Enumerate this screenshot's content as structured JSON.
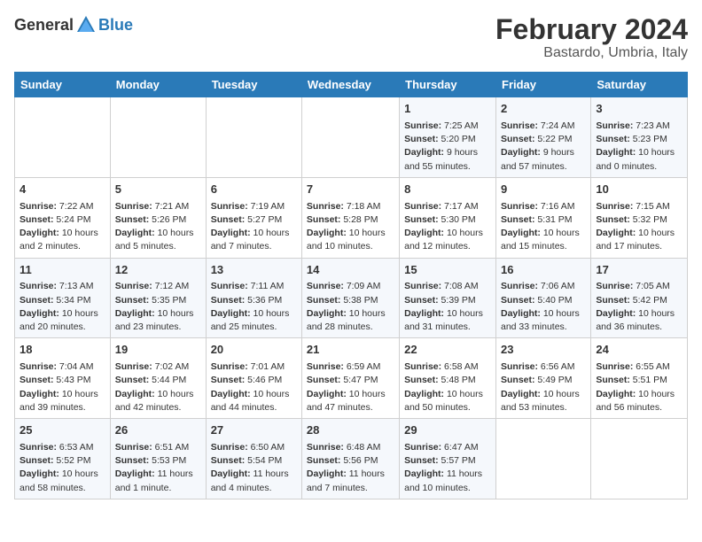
{
  "logo": {
    "general": "General",
    "blue": "Blue"
  },
  "title": "February 2024",
  "subtitle": "Bastardo, Umbria, Italy",
  "days_of_week": [
    "Sunday",
    "Monday",
    "Tuesday",
    "Wednesday",
    "Thursday",
    "Friday",
    "Saturday"
  ],
  "weeks": [
    [
      {
        "day": "",
        "info": ""
      },
      {
        "day": "",
        "info": ""
      },
      {
        "day": "",
        "info": ""
      },
      {
        "day": "",
        "info": ""
      },
      {
        "day": "1",
        "info": "Sunrise: 7:25 AM\nSunset: 5:20 PM\nDaylight: 9 hours and 55 minutes."
      },
      {
        "day": "2",
        "info": "Sunrise: 7:24 AM\nSunset: 5:22 PM\nDaylight: 9 hours and 57 minutes."
      },
      {
        "day": "3",
        "info": "Sunrise: 7:23 AM\nSunset: 5:23 PM\nDaylight: 10 hours and 0 minutes."
      }
    ],
    [
      {
        "day": "4",
        "info": "Sunrise: 7:22 AM\nSunset: 5:24 PM\nDaylight: 10 hours and 2 minutes."
      },
      {
        "day": "5",
        "info": "Sunrise: 7:21 AM\nSunset: 5:26 PM\nDaylight: 10 hours and 5 minutes."
      },
      {
        "day": "6",
        "info": "Sunrise: 7:19 AM\nSunset: 5:27 PM\nDaylight: 10 hours and 7 minutes."
      },
      {
        "day": "7",
        "info": "Sunrise: 7:18 AM\nSunset: 5:28 PM\nDaylight: 10 hours and 10 minutes."
      },
      {
        "day": "8",
        "info": "Sunrise: 7:17 AM\nSunset: 5:30 PM\nDaylight: 10 hours and 12 minutes."
      },
      {
        "day": "9",
        "info": "Sunrise: 7:16 AM\nSunset: 5:31 PM\nDaylight: 10 hours and 15 minutes."
      },
      {
        "day": "10",
        "info": "Sunrise: 7:15 AM\nSunset: 5:32 PM\nDaylight: 10 hours and 17 minutes."
      }
    ],
    [
      {
        "day": "11",
        "info": "Sunrise: 7:13 AM\nSunset: 5:34 PM\nDaylight: 10 hours and 20 minutes."
      },
      {
        "day": "12",
        "info": "Sunrise: 7:12 AM\nSunset: 5:35 PM\nDaylight: 10 hours and 23 minutes."
      },
      {
        "day": "13",
        "info": "Sunrise: 7:11 AM\nSunset: 5:36 PM\nDaylight: 10 hours and 25 minutes."
      },
      {
        "day": "14",
        "info": "Sunrise: 7:09 AM\nSunset: 5:38 PM\nDaylight: 10 hours and 28 minutes."
      },
      {
        "day": "15",
        "info": "Sunrise: 7:08 AM\nSunset: 5:39 PM\nDaylight: 10 hours and 31 minutes."
      },
      {
        "day": "16",
        "info": "Sunrise: 7:06 AM\nSunset: 5:40 PM\nDaylight: 10 hours and 33 minutes."
      },
      {
        "day": "17",
        "info": "Sunrise: 7:05 AM\nSunset: 5:42 PM\nDaylight: 10 hours and 36 minutes."
      }
    ],
    [
      {
        "day": "18",
        "info": "Sunrise: 7:04 AM\nSunset: 5:43 PM\nDaylight: 10 hours and 39 minutes."
      },
      {
        "day": "19",
        "info": "Sunrise: 7:02 AM\nSunset: 5:44 PM\nDaylight: 10 hours and 42 minutes."
      },
      {
        "day": "20",
        "info": "Sunrise: 7:01 AM\nSunset: 5:46 PM\nDaylight: 10 hours and 44 minutes."
      },
      {
        "day": "21",
        "info": "Sunrise: 6:59 AM\nSunset: 5:47 PM\nDaylight: 10 hours and 47 minutes."
      },
      {
        "day": "22",
        "info": "Sunrise: 6:58 AM\nSunset: 5:48 PM\nDaylight: 10 hours and 50 minutes."
      },
      {
        "day": "23",
        "info": "Sunrise: 6:56 AM\nSunset: 5:49 PM\nDaylight: 10 hours and 53 minutes."
      },
      {
        "day": "24",
        "info": "Sunrise: 6:55 AM\nSunset: 5:51 PM\nDaylight: 10 hours and 56 minutes."
      }
    ],
    [
      {
        "day": "25",
        "info": "Sunrise: 6:53 AM\nSunset: 5:52 PM\nDaylight: 10 hours and 58 minutes."
      },
      {
        "day": "26",
        "info": "Sunrise: 6:51 AM\nSunset: 5:53 PM\nDaylight: 11 hours and 1 minute."
      },
      {
        "day": "27",
        "info": "Sunrise: 6:50 AM\nSunset: 5:54 PM\nDaylight: 11 hours and 4 minutes."
      },
      {
        "day": "28",
        "info": "Sunrise: 6:48 AM\nSunset: 5:56 PM\nDaylight: 11 hours and 7 minutes."
      },
      {
        "day": "29",
        "info": "Sunrise: 6:47 AM\nSunset: 5:57 PM\nDaylight: 11 hours and 10 minutes."
      },
      {
        "day": "",
        "info": ""
      },
      {
        "day": "",
        "info": ""
      }
    ]
  ]
}
